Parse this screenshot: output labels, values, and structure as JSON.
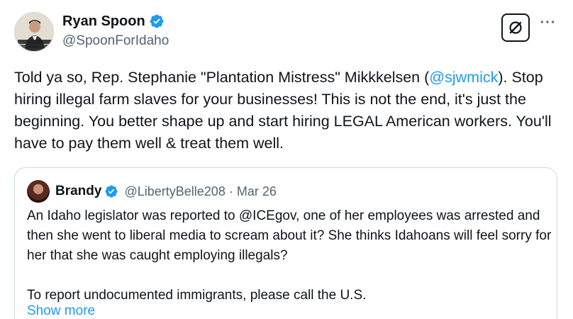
{
  "author": {
    "name": "Ryan Spoon",
    "handle": "@SpoonForIdaho"
  },
  "tweet": {
    "text_before": "Told ya so, Rep. Stephanie \"Plantation Mistress\" Mikkkelsen (",
    "mention": "@sjwmick",
    "text_after": "). Stop hiring illegal farm slaves for your businesses! This is not the end, it's just the beginning. You better shape up and start hiring LEGAL American workers. You'll have to pay them well & treat them well."
  },
  "quote": {
    "name": "Brandy",
    "handle": "@LibertyBelle208",
    "separator": "·",
    "date": "Mar 26",
    "paragraph_1": "An Idaho legislator was reported to @ICEgov, one of her employees was arrested and then she went to liberal media to scream about it? She thinks Idahoans will feel sorry for her that she was caught employing illegals?",
    "paragraph_2": "To report undocumented immigrants, please call the U.S.",
    "show_more": "Show more"
  },
  "icons": {
    "verified": "verified-badge-icon",
    "grok": "grok-icon",
    "more": "more-options-icon"
  },
  "colors": {
    "accent": "#1d9bf0",
    "text": "#0f1419",
    "secondary": "#536471",
    "border": "#cfd9de"
  }
}
